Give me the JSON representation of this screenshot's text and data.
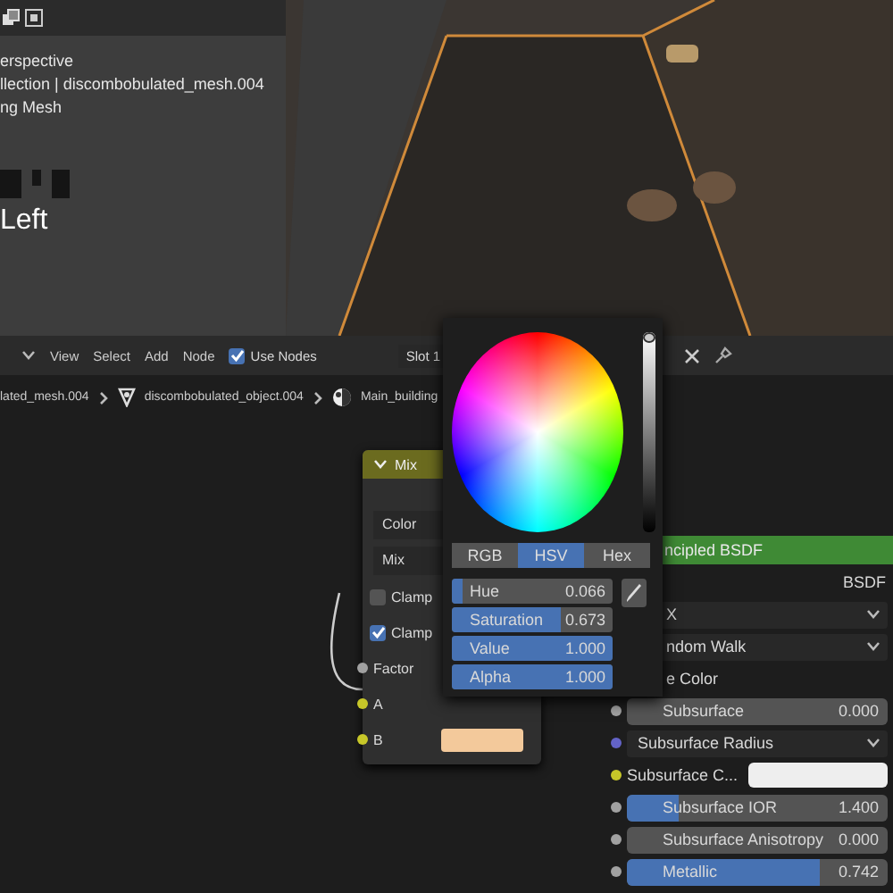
{
  "viewport": {
    "overlay_lines": [
      "erspective",
      "llection | discombobulated_mesh.004",
      "ng Mesh"
    ],
    "view_name": "Left"
  },
  "node_editor": {
    "header": {
      "menus": [
        "View",
        "Select",
        "Add",
        "Node"
      ],
      "use_nodes": {
        "label": "Use Nodes",
        "checked": true
      },
      "slot": "Slot 1"
    },
    "breadcrumbs": [
      {
        "kind": "mesh",
        "label": "lated_mesh.004"
      },
      {
        "kind": "object",
        "label": "discombobulated_object.004"
      },
      {
        "kind": "material",
        "label": "Main_building"
      }
    ],
    "mix_node": {
      "title": "Mix",
      "data_type": "Color",
      "blend": "Mix",
      "clamps": [
        {
          "label": "Clamp",
          "checked": false
        },
        {
          "label": "Clamp",
          "checked": true
        }
      ],
      "inputs": [
        {
          "label": "Factor",
          "color": "#a1a1a1"
        },
        {
          "label": "A",
          "color": "#c7c729"
        },
        {
          "label": "B",
          "color": "#c7c729",
          "swatch": {
            "color": "#f3c99b"
          }
        }
      ]
    }
  },
  "color_picker": {
    "value_bar": {
      "level": 1.0
    },
    "modes": [
      {
        "label": "RGB",
        "selected": false
      },
      {
        "label": "HSV",
        "selected": true
      },
      {
        "label": "Hex",
        "selected": false
      }
    ],
    "fields": [
      {
        "label": "Hue",
        "value": "0.066",
        "level": 0.066
      },
      {
        "label": "Saturation",
        "value": "0.673",
        "level": 0.673
      },
      {
        "label": "Value",
        "value": "1.000",
        "level": 1.0
      },
      {
        "label": "Alpha",
        "value": "1.000",
        "level": 1.0
      }
    ]
  },
  "properties": {
    "node_title": "ncipled BSDF",
    "output_label": "BSDF",
    "rows": [
      {
        "kind": "dropdown",
        "label": "X"
      },
      {
        "kind": "dropdown",
        "label": "ndom Walk"
      },
      {
        "kind": "text",
        "label": "e Color"
      },
      {
        "kind": "slider",
        "label": "Subsurface",
        "value": "0.000",
        "level": 0.0,
        "color": "#a1a1a1"
      },
      {
        "kind": "dropdown",
        "label": "Subsurface Radius",
        "color": "#6363c7"
      },
      {
        "kind": "color",
        "label": "Subsurface C...",
        "color": "#c7c729",
        "swatch": {
          "color": "#eeeeee"
        }
      },
      {
        "kind": "slider",
        "label": "Subsurface IOR",
        "value": "1.400",
        "level": 0.2,
        "color": "#a1a1a1"
      },
      {
        "kind": "slider",
        "label": "Subsurface Anisotropy",
        "value": "0.000",
        "level": 0.0,
        "color": "#a1a1a1"
      },
      {
        "kind": "slider",
        "label": "Metallic",
        "value": "0.742",
        "level": 0.742,
        "color": "#a1a1a1"
      }
    ]
  }
}
